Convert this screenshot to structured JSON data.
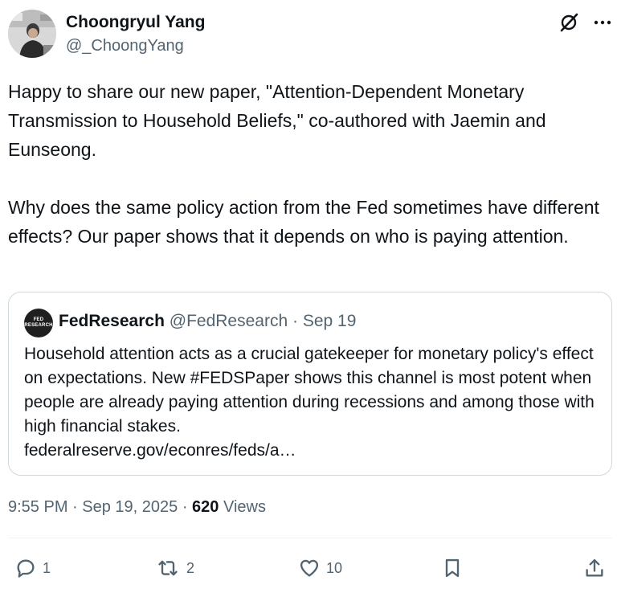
{
  "author": {
    "name": "Choongryul Yang",
    "handle": "@_ChoongYang"
  },
  "header_icons": [
    "grok-icon",
    "more-icon"
  ],
  "body": {
    "paragraph1": "Happy to share our new paper, \"Attention-Dependent Monetary Transmission to Household Beliefs,\" co-authored with Jaemin and Eunseong.",
    "paragraph2": "Why does the same policy action from the Fed sometimes have different effects? Our paper shows that it depends on who is paying attention."
  },
  "quote": {
    "avatar_text_top": "FED",
    "avatar_text_bottom": "RESEARCH",
    "name": "FedResearch",
    "handle": "@FedResearch",
    "separator": " · ",
    "date": "Sep 19",
    "text": "Household attention acts as a crucial gatekeeper for monetary policy's effect on expectations. New #FEDSPaper shows this channel is most potent when people are already paying attention during recessions and among those with high financial stakes.",
    "link": "federalreserve.gov/econres/feds/a…"
  },
  "meta": {
    "time": "9:55 PM",
    "sep1": " · ",
    "date": "Sep 19, 2025",
    "sep2": " · ",
    "views_count": "620",
    "views_label": " Views"
  },
  "actions": {
    "reply_count": "1",
    "retweet_count": "2",
    "like_count": "10",
    "bookmark_count": "",
    "share_count": ""
  },
  "colors": {
    "text": "#0f1419",
    "secondary": "#536471",
    "border": "#cfd9de"
  }
}
